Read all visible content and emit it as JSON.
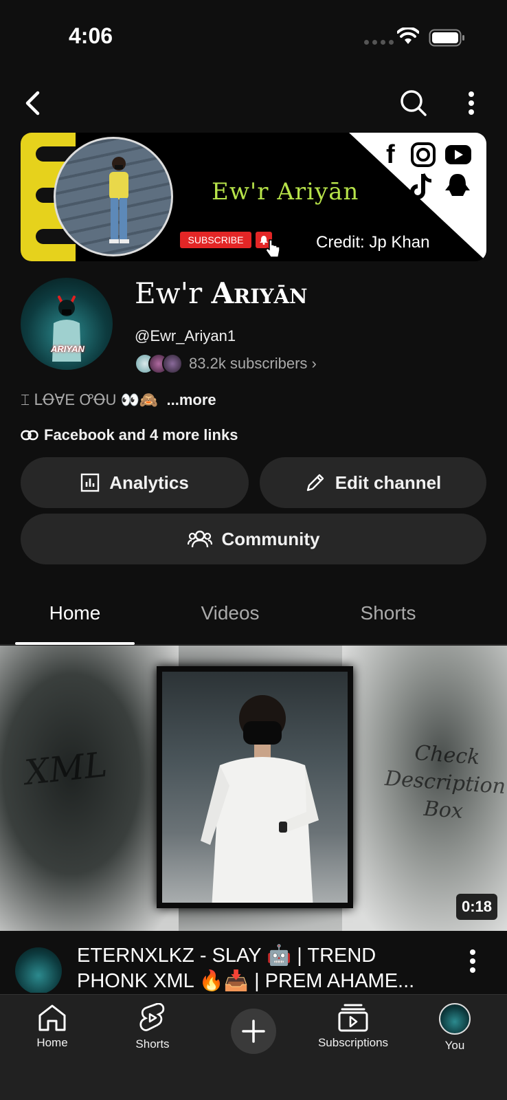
{
  "status_bar": {
    "time": "4:06"
  },
  "banner": {
    "title": "Ew'r Ariyān",
    "subscribe_label": "SUBSCRIBE",
    "credit": "Credit: Jp Khan",
    "social_icons": [
      "facebook-icon",
      "instagram-icon",
      "youtube-icon",
      "tiktok-icon",
      "snapchat-icon"
    ]
  },
  "channel": {
    "name_prefix": "Ew'r ",
    "name_styled": "Ariyān",
    "handle": "@Ewr_Ariyan1",
    "subscribers": "83.2k subscribers ›",
    "description": "⌶ ⅬꝊⱯE ꝌꝊU 👀🙈",
    "description_more": "...more",
    "links": "Facebook and 4 more links",
    "avatar_tag": "ARIYAN"
  },
  "actions": {
    "analytics": "Analytics",
    "edit_channel": "Edit channel",
    "community": "Community"
  },
  "tabs": [
    {
      "label": "Home",
      "active": true
    },
    {
      "label": "Videos",
      "active": false
    },
    {
      "label": "Shorts",
      "active": false
    }
  ],
  "featured_video": {
    "duration": "0:18",
    "title": "ETERNXLKZ - SLAY 🤖 | TREND PHONK XML 🔥📥 | PREM AHAME...",
    "thumbnail_text_left": "XML",
    "thumbnail_text_right": [
      "Check",
      "Description",
      "Box"
    ]
  },
  "bottom_nav": [
    {
      "label": "Home",
      "icon": "home-icon"
    },
    {
      "label": "Shorts",
      "icon": "shorts-icon"
    },
    {
      "label": "",
      "icon": "create-icon"
    },
    {
      "label": "Subscriptions",
      "icon": "subscriptions-icon"
    },
    {
      "label": "You",
      "icon": "you-avatar"
    }
  ],
  "colors": {
    "background": "#0f0f0f",
    "button": "#272727",
    "accent_red": "#e32626",
    "banner_green": "#b7e34a"
  }
}
